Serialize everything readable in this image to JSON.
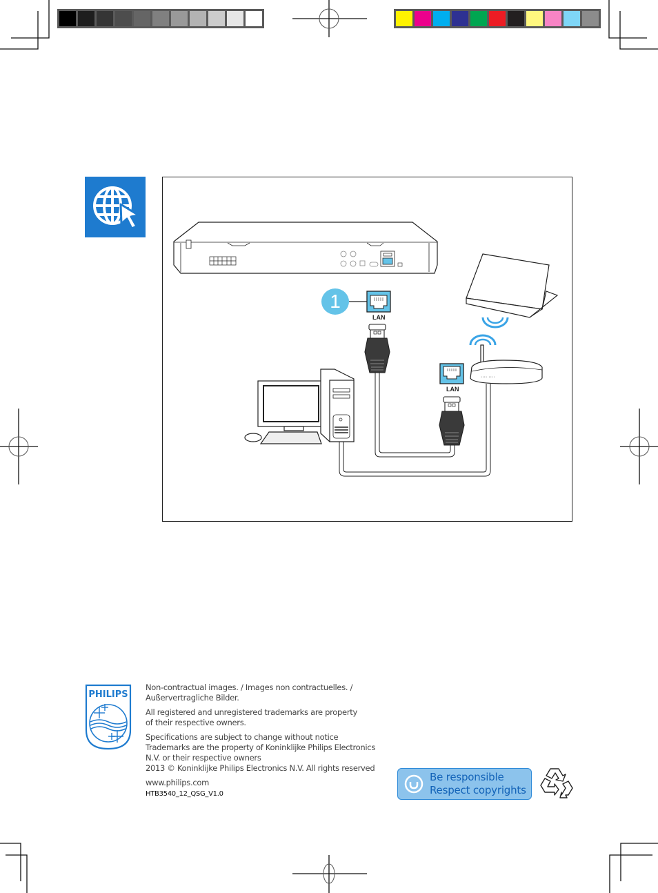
{
  "color_bars": {
    "grayscale": [
      "#000000",
      "#1e1e1e",
      "#353535",
      "#4d4d4d",
      "#656565",
      "#808080",
      "#999999",
      "#b3b3b3",
      "#cccccc",
      "#e6e6e6",
      "#ffffff"
    ],
    "process": [
      "#fff200",
      "#ec008c",
      "#00aeef",
      "#2e3192",
      "#00a651",
      "#ed1c24",
      "#231f20",
      "#fff77f",
      "#f784c5",
      "#7fd6f7",
      "#8c8c8c"
    ]
  },
  "section_icon": {
    "icon": "globe-cursor-icon",
    "color": "#1e7bcf"
  },
  "diagram": {
    "step_number": "1",
    "player_port_label": "LAN",
    "router_port_label": "LAN",
    "accent_color": "#64c3e8",
    "devices": [
      "home-theater-player",
      "tablet",
      "router",
      "desktop-computer"
    ]
  },
  "footer": {
    "brand": "PHILIPS",
    "lines": [
      "Non-contractual images. / Images non contractuelles. /",
      "Außervertragliche Bilder.",
      "All registered and unregistered trademarks are property",
      "of their respective owners.",
      "Specifications are subject to change without notice",
      "Trademarks are the property of Koninklijke Philips Electronics",
      "N.V. or their respective owners",
      "2013 © Koninklijke Philips Electronics N.V.  All rights reserved"
    ],
    "website": "www.philips.com",
    "doc_code": "HTB3540_12_QSG_V1.0",
    "respect_line1": "Be responsible",
    "respect_line2": "Respect copyrights"
  }
}
